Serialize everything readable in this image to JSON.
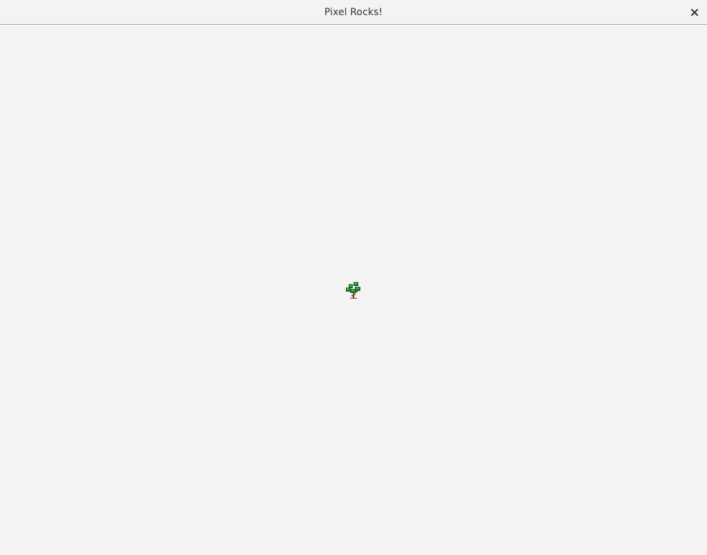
{
  "window": {
    "title": "Pixel Rocks!",
    "close_icon": "close-icon"
  },
  "canvas": {
    "background": "#f4f4f4",
    "sprite": {
      "type": "tree",
      "icon": "tree-icon",
      "foliage_color": "#2e8b2e",
      "trunk_color": "#7a4a1e"
    }
  }
}
